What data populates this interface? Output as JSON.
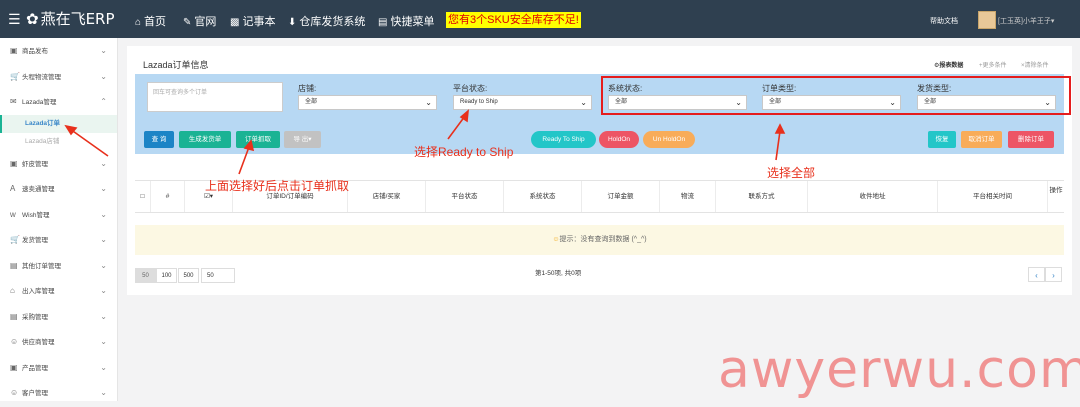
{
  "topbar": {
    "logo": "燕在飞ERP",
    "nav": [
      {
        "icon": "home-icon",
        "label": "首页"
      },
      {
        "icon": "pen-icon",
        "label": "官网"
      },
      {
        "icon": "book-icon",
        "label": "记事本"
      },
      {
        "icon": "download-icon",
        "label": "仓库发货系统"
      },
      {
        "icon": "menu-icon",
        "label": "快捷菜单"
      }
    ],
    "warning": "您有3个SKU安全库存不足!",
    "help": "帮助文档",
    "user": "[工玉英]小羊王子"
  },
  "sidebar": {
    "items": [
      {
        "label": "商品发布",
        "icon": "clipboard-icon",
        "expanded": false
      },
      {
        "label": "头程物流管理",
        "icon": "cart-icon",
        "expanded": false
      },
      {
        "label": "Lazada管理",
        "icon": "chat-icon",
        "expanded": true
      },
      {
        "label": "虾皮管理",
        "icon": "box-icon",
        "expanded": false
      },
      {
        "label": "速卖通管理",
        "icon": "ali-icon",
        "expanded": false
      },
      {
        "label": "Wish管理",
        "icon": "wish-icon",
        "expanded": false
      },
      {
        "label": "发货管理",
        "icon": "cart-icon",
        "expanded": false
      },
      {
        "label": "其他订单管理",
        "icon": "doc-icon",
        "expanded": false
      },
      {
        "label": "出入库管理",
        "icon": "house-icon",
        "expanded": false
      },
      {
        "label": "采购管理",
        "icon": "form-icon",
        "expanded": false
      },
      {
        "label": "供应商管理",
        "icon": "people-icon",
        "expanded": false
      },
      {
        "label": "产品管理",
        "icon": "clipboard-icon",
        "expanded": false
      },
      {
        "label": "客户管理",
        "icon": "person-icon",
        "expanded": false
      }
    ],
    "sub": [
      "Lazada订单",
      "Lazada店铺"
    ]
  },
  "main": {
    "title": "Lazada订单信息",
    "links": [
      "报表数据",
      "更多条件",
      "清除条件"
    ],
    "search_placeholder": "回车可查询多个订单",
    "filters": [
      {
        "label": "店铺:",
        "value": "全部"
      },
      {
        "label": "平台状态:",
        "value": "Ready to Ship"
      },
      {
        "label": "系统状态:",
        "value": "全部"
      },
      {
        "label": "订单类型:",
        "value": "全部"
      },
      {
        "label": "发货类型:",
        "value": "全部"
      }
    ],
    "buttons": {
      "query": "查 询",
      "create_ship": "生成发货单",
      "fetch": "订单抓取",
      "export": "导 出",
      "ready_to_ship": "Ready To Ship",
      "hold_on": "HoldOn",
      "un_hold_on": "Un HoldOn",
      "restore": "恢复",
      "cancel_order": "取消订单",
      "delete_order": "删除订单"
    },
    "columns": [
      "#",
      "订单ID/订单编码",
      "店铺/买家",
      "平台状态",
      "系统状态",
      "订单金额",
      "物流",
      "联系方式",
      "收件地址",
      "平台相关时间",
      "操作"
    ],
    "empty_message": "提示：没有查询到数据 (^_^)",
    "page_sizes": [
      "50",
      "100",
      "500",
      "50"
    ],
    "pager_info": "第1-50项, 共0项"
  },
  "annotations": {
    "select_ready": "选择Ready to Ship",
    "select_all": "选择全部",
    "fetch_hint": "上面选择好后点击订单抓取"
  },
  "watermark": "awyerwu.com",
  "colors": {
    "topbar": "#2f4050",
    "filter_bg": "#b7d8f3",
    "primary": "#1c84c6",
    "success": "#1ab394",
    "annotation": "#e8301c"
  }
}
